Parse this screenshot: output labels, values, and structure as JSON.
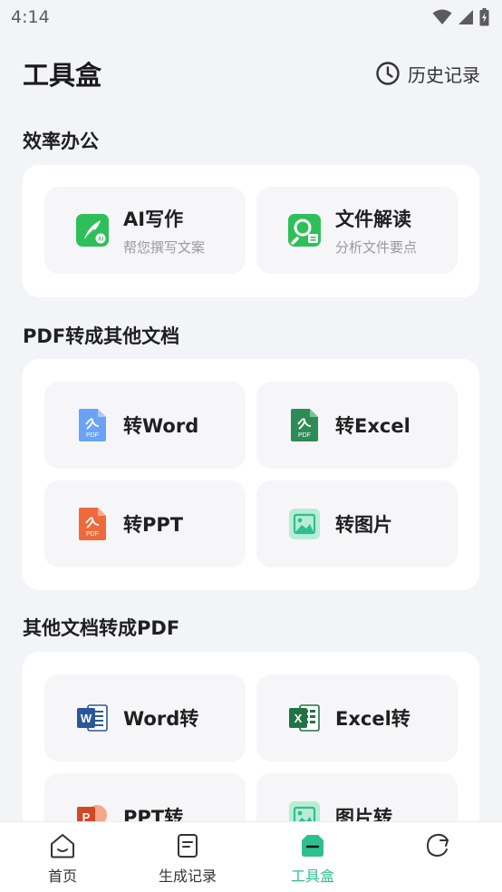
{
  "status_bar": {
    "time": "4:14"
  },
  "header": {
    "title": "工具盒",
    "history_label": "历史记录"
  },
  "sections": [
    {
      "title": "效率办公",
      "tiles": [
        {
          "label": "AI写作",
          "sub": "帮您撰写文案",
          "icon": "ai-writing-icon"
        },
        {
          "label": "文件解读",
          "sub": "分析文件要点",
          "icon": "file-analysis-icon"
        }
      ]
    },
    {
      "title": "PDF转成其他文档",
      "tiles": [
        {
          "label": "转Word",
          "icon": "pdf-blue-icon"
        },
        {
          "label": "转Excel",
          "icon": "pdf-green-icon"
        },
        {
          "label": "转PPT",
          "icon": "pdf-orange-icon"
        },
        {
          "label": "转图片",
          "icon": "image-icon"
        }
      ]
    },
    {
      "title": "其他文档转成PDF",
      "tiles": [
        {
          "label": "Word转",
          "icon": "word-icon"
        },
        {
          "label": "Excel转",
          "icon": "excel-icon"
        },
        {
          "label": "PPT转",
          "icon": "ppt-icon"
        },
        {
          "label": "图片转",
          "icon": "image-icon"
        }
      ]
    }
  ],
  "bottom_nav": [
    {
      "label": "首页",
      "icon": "home-icon",
      "active": false
    },
    {
      "label": "生成记录",
      "icon": "document-icon",
      "active": false
    },
    {
      "label": "工具盒",
      "icon": "toolbox-icon",
      "active": true
    },
    {
      "label": "",
      "icon": "profile-icon",
      "active": false
    }
  ],
  "colors": {
    "accent": "#2fbf8f",
    "background": "#f3f4f7",
    "card": "#ffffff",
    "tile": "#f6f6f8",
    "pdf_blue": "#6aa3f5",
    "pdf_green": "#2e8b57",
    "pdf_orange": "#ee6a3c",
    "word_blue": "#2b579a",
    "excel_green": "#217346",
    "ppt_red": "#d24726"
  }
}
